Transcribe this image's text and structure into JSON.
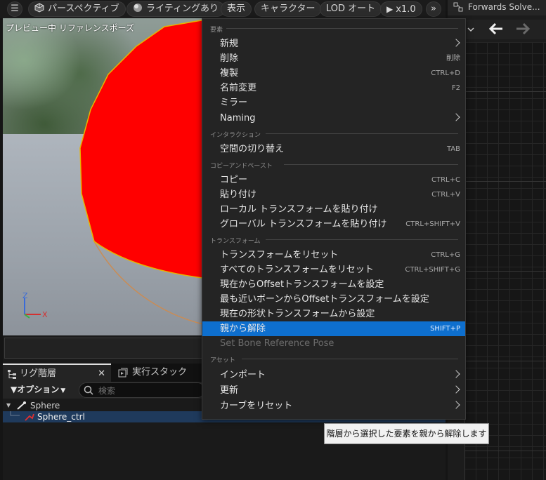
{
  "toolbar": {
    "perspective_label": "パースペクティブ",
    "lighting_label": "ライティングあり",
    "show_label": "表示",
    "character_label": "キャラクター",
    "lod_label": "LOD オート",
    "play_speed_label": "x1.0"
  },
  "viewport": {
    "preview_label": "プレビュー中 リファレンスポーズ",
    "axis_z": "Z",
    "axis_x": "X",
    "sphere_color": "#ff0000",
    "outline_color": "#e8b400"
  },
  "right_panel": {
    "title": "Forwards Solve..."
  },
  "hierarchy": {
    "tab_rig": "リグ階層",
    "tab_exec": "実行スタック",
    "options_label": "オプション",
    "search_placeholder": "検索",
    "rows": [
      {
        "label": "Sphere"
      },
      {
        "label": "Sphere_ctrl"
      }
    ]
  },
  "menu": {
    "sections": {
      "elements": "要素",
      "interaction": "インタラクション",
      "copy_paste": "コピーアンドペースト",
      "transform": "トランスフォーム",
      "asset": "アセット"
    },
    "items": {
      "new": {
        "label": "新規"
      },
      "delete": {
        "label": "削除",
        "shortcut": "削除"
      },
      "duplicate": {
        "label": "複製",
        "shortcut": "CTRL+D"
      },
      "rename": {
        "label": "名前変更",
        "shortcut": "F2"
      },
      "mirror": {
        "label": "ミラー"
      },
      "naming": {
        "label": "Naming"
      },
      "space_switch": {
        "label": "空間の切り替え",
        "shortcut": "TAB"
      },
      "copy": {
        "label": "コピー",
        "shortcut": "CTRL+C"
      },
      "paste": {
        "label": "貼り付け",
        "shortcut": "CTRL+V"
      },
      "paste_local": {
        "label": "ローカル トランスフォームを貼り付け"
      },
      "paste_global": {
        "label": "グローバル トランスフォームを貼り付け",
        "shortcut": "CTRL+SHIFT+V"
      },
      "reset_transform": {
        "label": "トランスフォームをリセット",
        "shortcut": "CTRL+G"
      },
      "reset_all": {
        "label": "すべてのトランスフォームをリセット",
        "shortcut": "CTRL+SHIFT+G"
      },
      "offset_current": {
        "label": "現在からOffsetトランスフォームを設定"
      },
      "offset_nearest": {
        "label": "最も近いボーンからOffsetトランスフォームを設定"
      },
      "set_from_shape": {
        "label": "現在の形状トランスフォームから設定"
      },
      "unparent": {
        "label": "親から解除",
        "shortcut": "SHIFT+P"
      },
      "set_bone_ref": {
        "label": "Set Bone Reference Pose"
      },
      "import": {
        "label": "インポート"
      },
      "update": {
        "label": "更新"
      },
      "reset_curve": {
        "label": "カーブをリセット"
      }
    },
    "highlight_color": "#0e6fce"
  },
  "tooltip": {
    "text": "階層から選択した要素を親から解除します"
  }
}
